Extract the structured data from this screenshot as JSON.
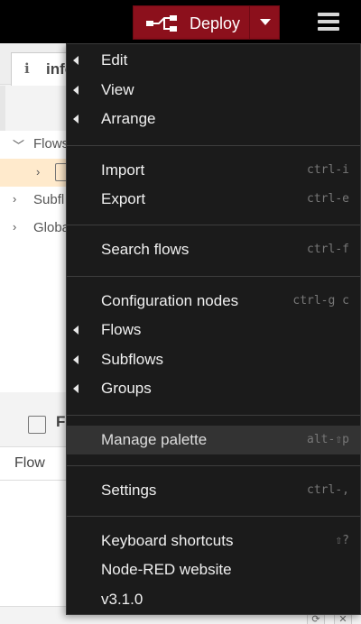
{
  "header": {
    "deploy_label": "Deploy",
    "colors": {
      "header_bg": "#000000",
      "deploy_bg": "#8c101c"
    }
  },
  "sidebar": {
    "info_tab_label": "info",
    "tree": [
      {
        "label": "Flows"
      },
      {
        "label": ""
      },
      {
        "label": "Subfl"
      },
      {
        "label": "Globa"
      }
    ],
    "lower_title": "F",
    "flow_row_label": "Flow"
  },
  "menu": {
    "items": [
      {
        "label": "Edit",
        "shortcut": "",
        "submenu": true
      },
      {
        "label": "View",
        "shortcut": "",
        "submenu": true
      },
      {
        "label": "Arrange",
        "shortcut": "",
        "submenu": true
      },
      {
        "label": "Import",
        "shortcut": "ctrl-i",
        "submenu": false
      },
      {
        "label": "Export",
        "shortcut": "ctrl-e",
        "submenu": false
      },
      {
        "label": "Search flows",
        "shortcut": "ctrl-f",
        "submenu": false
      },
      {
        "label": "Configuration nodes",
        "shortcut": "ctrl-g c",
        "submenu": false
      },
      {
        "label": "Flows",
        "shortcut": "",
        "submenu": true
      },
      {
        "label": "Subflows",
        "shortcut": "",
        "submenu": true
      },
      {
        "label": "Groups",
        "shortcut": "",
        "submenu": true
      },
      {
        "label": "Manage palette",
        "shortcut": "alt-⇧p",
        "submenu": false,
        "active": true
      },
      {
        "label": "Settings",
        "shortcut": "ctrl-,",
        "submenu": false
      },
      {
        "label": "Keyboard shortcuts",
        "shortcut": "⇧?",
        "submenu": false
      },
      {
        "label": "Node-RED website",
        "shortcut": "",
        "submenu": false
      },
      {
        "label": "v3.1.0",
        "shortcut": "",
        "submenu": false
      }
    ]
  }
}
